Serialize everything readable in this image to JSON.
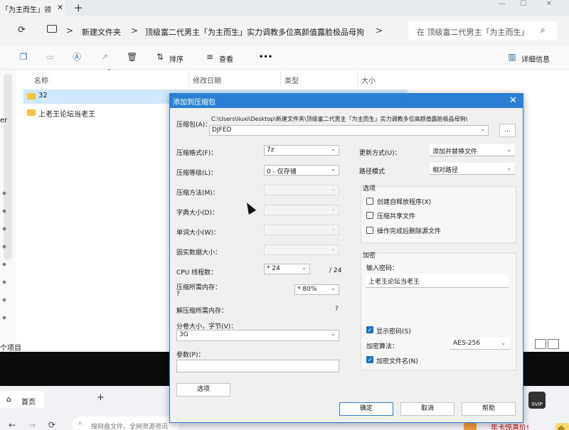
{
  "explorer": {
    "tab_title": "「为主而生」领",
    "tab_close": "✕",
    "new_tab": "+",
    "window_controls": [
      "—",
      "☐",
      "✕"
    ],
    "breadcrumbs": [
      "新建文件夹",
      "顶级富二代男主「为主而生」实力调教多位高颜值露脸极品母狗"
    ],
    "separator": ">",
    "search_placeholder": "在 顶级富二代男主「为主而生」",
    "toolbar": {
      "sort_label": "排序",
      "view_label": "查看",
      "more_label": "•••",
      "details_label": "详细信息"
    },
    "columns": [
      "名称",
      "修改日期",
      "类型",
      "大小"
    ],
    "rows": [
      {
        "name": "32"
      },
      {
        "name": "上老王论坛当老王"
      }
    ],
    "sidebar_partial": "er",
    "status_partial": "个项目"
  },
  "browser": {
    "home_tab": "首页",
    "url_placeholder": "搜网盘文件、全网资源资讯",
    "promo": "年卡惊喜价!",
    "vip": "会员",
    "app_badge": "SVIP"
  },
  "dialog": {
    "title": "添加到压缩包",
    "archive_label": "压缩包(A)：",
    "archive_path": "C:\\Users\\liuxi\\Desktop\\新建文件夹\\顶级富二代男主「为主而生」实力调教多位高颜值露脸极品母狗\\",
    "archive_name": "DJFED",
    "browse_button": "...",
    "format_label": "压缩格式(F)：",
    "format_value": "7z",
    "level_label": "压缩等级(L)：",
    "level_value": "0 - 仅存储",
    "method_label": "压缩方法(M)：",
    "dict_label": "字典大小(D)：",
    "word_label": "单词大小(W)：",
    "solid_label": "固实数据大小：",
    "cpu_label": "CPU 线程数：",
    "cpu_value": "* 24",
    "cpu_total": "/ 24",
    "mem_label": "压缩所需内存：",
    "mem_q": "?",
    "mem_value": "* 80%",
    "decomp_label": "解压缩所需内存：",
    "decomp_value": "?",
    "volume_label": "分卷大小，字节(V)：",
    "volume_value": "3G",
    "params_label": "参数(P)：",
    "params_value": "",
    "options_button": "选项",
    "update_label": "更新方式(U)：",
    "update_value": "添加并替换文件",
    "pathmode_label": "路径模式",
    "pathmode_value": "相对路径",
    "options_group": "选项",
    "opt_sfx": "创建自释放程序(X)",
    "opt_shared": "压缩共享文件",
    "opt_delete": "操作完成后删除源文件",
    "encrypt_group": "加密",
    "password_label": "输入密码：",
    "password_value": "上老王论坛当老王",
    "show_password": "显示密码(S)",
    "enc_method_label": "加密算法：",
    "enc_method_value": "AES-256",
    "encrypt_names": "加密文件名(N)",
    "ok_button": "确定",
    "cancel_button": "取消",
    "help_button": "帮助",
    "arrow": "⌄",
    "check": "✓"
  }
}
